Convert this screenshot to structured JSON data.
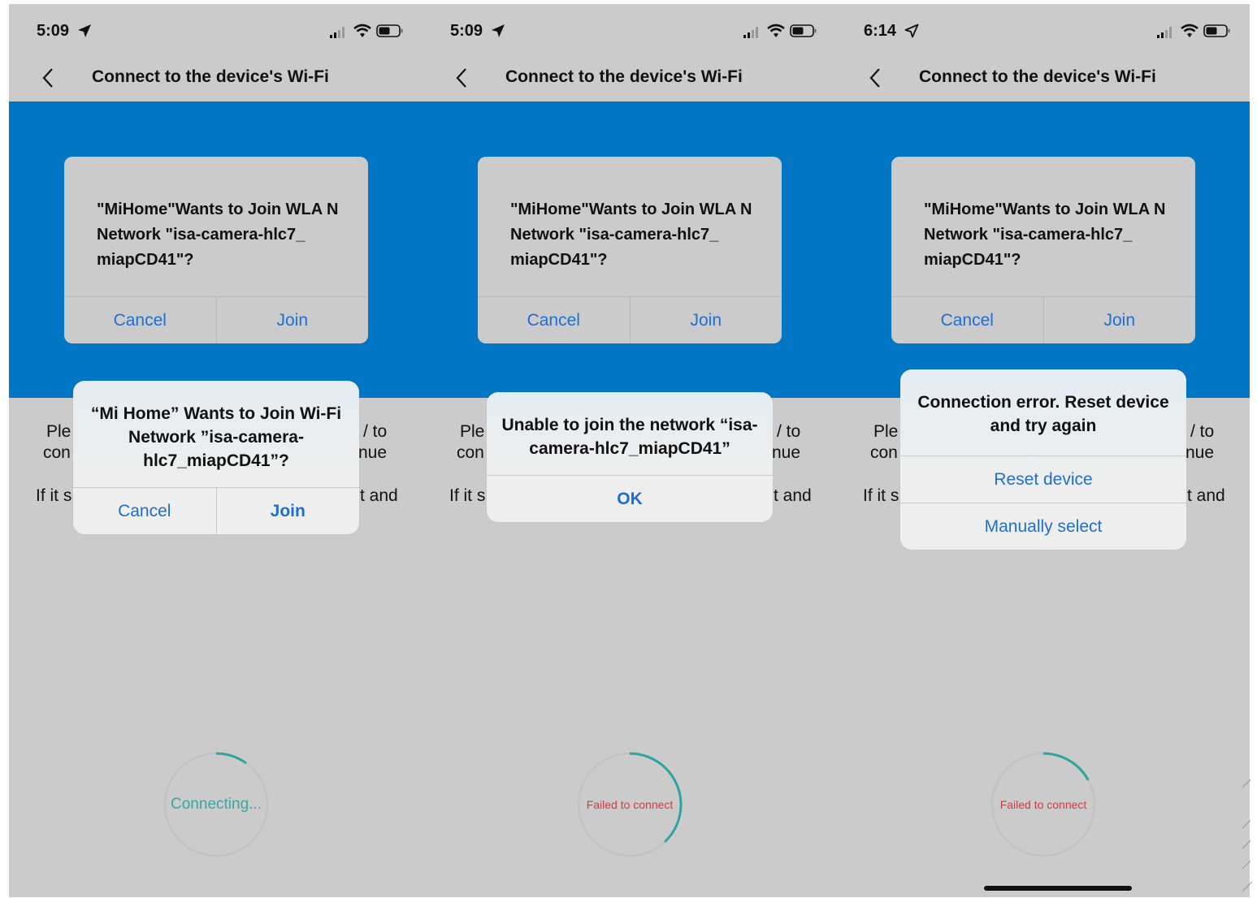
{
  "screens": [
    {
      "status": {
        "time": "5:09",
        "location_icon": "location-arrow-filled-icon"
      },
      "nav": {
        "title": "Connect to the device's Wi-Fi"
      },
      "mock_dialog": {
        "message": "\"MiHome\"Wants to Join WLA N Network \"isa-camera-hlc7_ miapCD41\"?",
        "cancel": "Cancel",
        "join": "Join"
      },
      "instr": {
        "a": "Ple",
        "b": "/ to",
        "c": "con",
        "d": "nue",
        "e": "If it s",
        "f": "t and"
      },
      "alert": {
        "title": "“Mi Home” Wants to Join Wi-Fi Network ”isa-camera-hlc7_miapCD41”?",
        "cancel": "Cancel",
        "join": "Join"
      },
      "progress": {
        "label": "Connecting...",
        "fraction": 0.1
      }
    },
    {
      "status": {
        "time": "5:09",
        "location_icon": "location-arrow-filled-icon"
      },
      "nav": {
        "title": "Connect to the device's Wi-Fi"
      },
      "mock_dialog": {
        "message": "\"MiHome\"Wants to Join WLA N Network \"isa-camera-hlc7_ miapCD41\"?",
        "cancel": "Cancel",
        "join": "Join"
      },
      "instr": {
        "a": "Ple",
        "b": "/ to",
        "c": "con",
        "d": "nue",
        "e": "If it s",
        "f": "t and"
      },
      "alert": {
        "title": "Unable to join the network “isa-camera-hlc7_miapCD41”",
        "ok": "OK"
      },
      "progress": {
        "label": "Failed to connect",
        "fraction": 0.38
      }
    },
    {
      "status": {
        "time": "6:14",
        "location_icon": "location-arrow-outline-icon"
      },
      "nav": {
        "title": "Connect to the device's Wi-Fi"
      },
      "mock_dialog": {
        "message": "\"MiHome\"Wants to Join WLA N Network \"isa-camera-hlc7_ miapCD41\"?",
        "cancel": "Cancel",
        "join": "Join"
      },
      "instr": {
        "a": "Ple",
        "b": "/ to",
        "c": "con",
        "d": "nue",
        "e": "If it s",
        "f": "t and"
      },
      "alert": {
        "title": "Connection error. Reset device and try again",
        "reset": "Reset device",
        "manual": "Manually select"
      },
      "progress": {
        "label": "Failed to connect",
        "fraction": 0.17
      }
    }
  ],
  "colors": {
    "hero_blue": "#0076c4",
    "link_blue": "#1f6fd0",
    "progress_teal": "#2fa3a3",
    "ring_track": "#c2c2c2",
    "error_red": "#d9363e",
    "screen_gray": "#cbcbcb"
  }
}
